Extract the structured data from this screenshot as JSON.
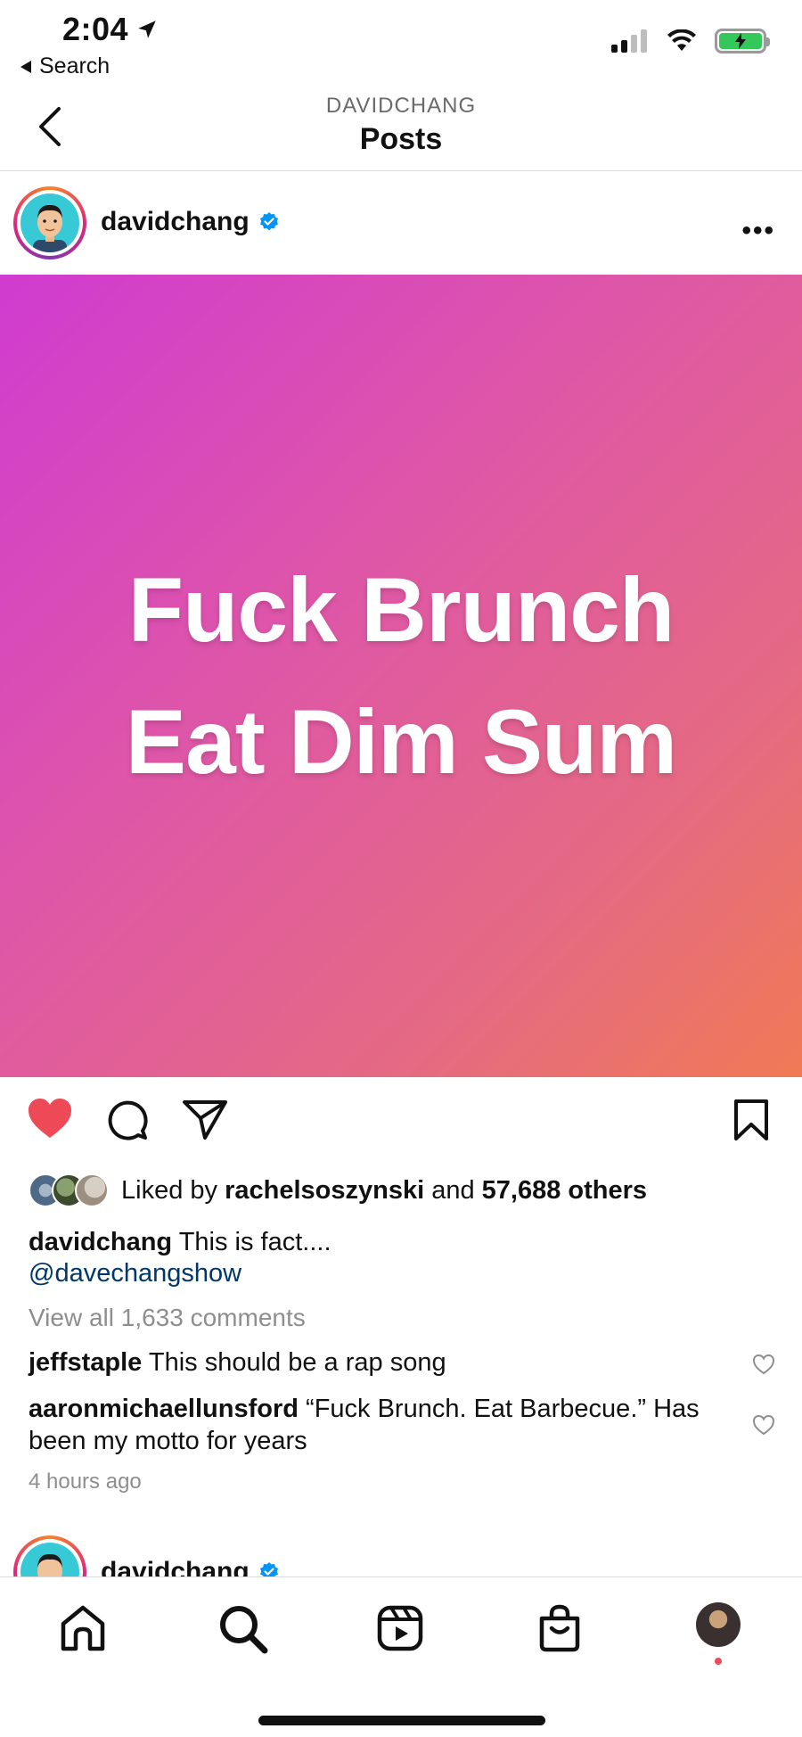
{
  "status_bar": {
    "time": "2:04",
    "back_label": "Search"
  },
  "header": {
    "subtitle": "DAVIDCHANG",
    "title": "Posts"
  },
  "post": {
    "username": "davidchang",
    "image_lines": [
      "Fuck Brunch",
      "Eat Dim Sum"
    ],
    "image_gradient": [
      "#d03bd0",
      "#de56a8",
      "#e56a82",
      "#f07a55"
    ],
    "liked": true,
    "likes_prefix": "Liked by",
    "liked_by_user": "rachelsoszynski",
    "likes_and": "and",
    "likes_others": "57,688 others",
    "caption_user": "davidchang",
    "caption_text": "This is fact....",
    "caption_mention": "@davechangshow",
    "view_all": "View all 1,633 comments",
    "comments": [
      {
        "user": "jeffstaple",
        "text": "This should be a rap song"
      },
      {
        "user": "aaronmichaellunsford",
        "text": "“Fuck Brunch. Eat Barbecue.” Has been my motto for years"
      }
    ],
    "time_ago": "4 hours ago"
  },
  "next_post": {
    "username": "davidchang"
  },
  "tabbar": {
    "items": [
      "home-icon",
      "search-icon",
      "reels-icon",
      "shop-icon",
      "profile-avatar"
    ]
  },
  "colors": {
    "like_red": "#ed4956",
    "verified_blue": "#0095f6",
    "mention_blue": "#00376b",
    "muted_gray": "#8e8e8e"
  }
}
